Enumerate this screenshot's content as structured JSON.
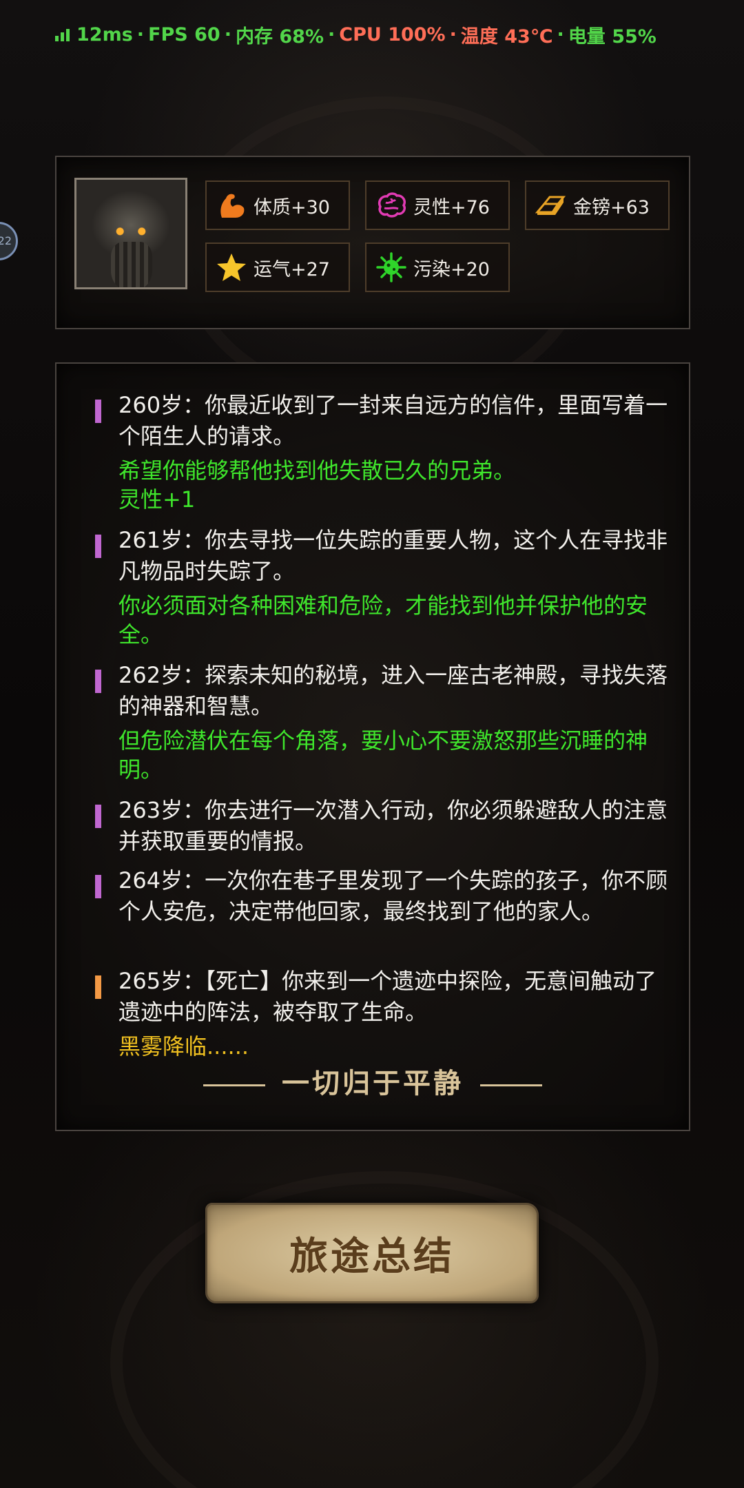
{
  "status_bar": {
    "latency": "12ms",
    "fps": "FPS 60",
    "memory": "内存 68%",
    "cpu": "CPU 100%",
    "temperature": "温度 43℃",
    "battery": "电量 55%",
    "separator": "·",
    "colors": {
      "ok": "#52d64a",
      "warn": "#ff6e57"
    }
  },
  "side_badge": {
    "text": "22"
  },
  "attributes": [
    {
      "icon": "muscle-arm-icon",
      "label": "体质+30",
      "color": "#f07b1e"
    },
    {
      "icon": "brain-icon",
      "label": "灵性+76",
      "color": "#e23bb4"
    },
    {
      "icon": "gold-bars-icon",
      "label": "金镑+63",
      "color": "#e8a325"
    },
    {
      "icon": "star-icon",
      "label": "运气+27",
      "color": "#f7c52b"
    },
    {
      "icon": "germ-icon",
      "label": "污染+20",
      "color": "#2fd62a"
    }
  ],
  "log": [
    {
      "text": "260岁：你最近收到了一封来自远方的信件，里面写着一个陌生人的请求。",
      "note": "希望你能够帮他找到他失散已久的兄弟。\n灵性+1",
      "marker_color": "#c067d0"
    },
    {
      "text": "261岁：你去寻找一位失踪的重要人物，这个人在寻找非凡物品时失踪了。",
      "note": "你必须面对各种困难和危险，才能找到他并保护他的安全。",
      "marker_color": "#c067d0"
    },
    {
      "text": "262岁：探索未知的秘境，进入一座古老神殿，寻找失落的神器和智慧。",
      "note": "但危险潜伏在每个角落，要小心不要激怒那些沉睡的神明。",
      "marker_color": "#c067d0"
    },
    {
      "text": "263岁：你去进行一次潜入行动，你必须躲避敌人的注意并获取重要的情报。",
      "note": "",
      "marker_color": "#c067d0"
    },
    {
      "text": "264岁：一次你在巷子里发现了一个失踪的孩子，你不顾个人安危，决定带他回家，最终找到了他的家人。",
      "note": "",
      "marker_color": "#c067d0"
    },
    {
      "text": "265岁：【死亡】你来到一个遗迹中探险，无意间触动了遗迹中的阵法，被夺取了生命。",
      "note": "黑雾降临......",
      "marker_color": "#f39945"
    }
  ],
  "ending_text": "一切归于平静",
  "summary_button_label": "旅途总结"
}
